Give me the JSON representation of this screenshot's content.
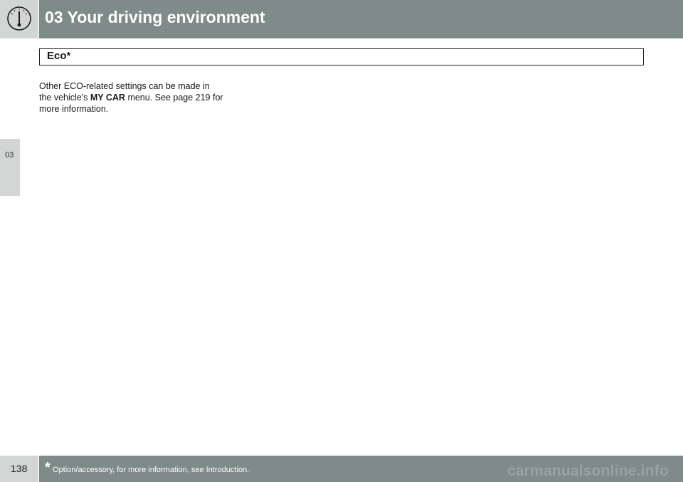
{
  "header": {
    "title": "03 Your driving environment",
    "icon": "speedometer-icon"
  },
  "side_tab": {
    "label": "03"
  },
  "section": {
    "title": "Eco*"
  },
  "body": {
    "text_before": "Other ECO-related settings can be made in the vehicle's ",
    "bold_term": "MY CAR",
    "text_after": " menu. See page 219 for more information."
  },
  "footer": {
    "page_number": "138",
    "asterisk": "*",
    "note": "Option/accessory, for more information, see Introduction.",
    "watermark": "carmanualsonline.info"
  },
  "colors": {
    "bar": "#7f8b89",
    "tab": "#d2d5d4",
    "text": "#1a1a1a"
  }
}
